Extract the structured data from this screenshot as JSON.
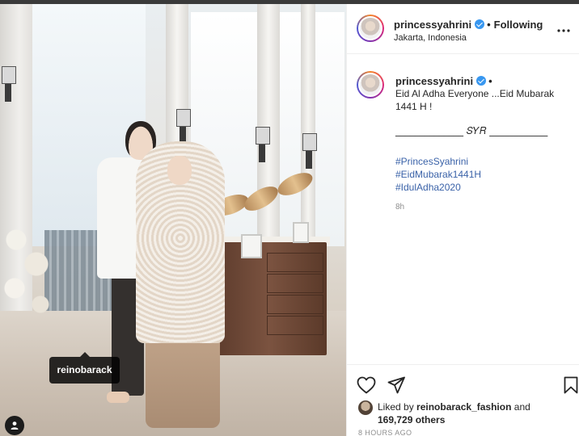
{
  "photo": {
    "tag_label": "reinobarack",
    "tagged_icon": "person-icon"
  },
  "post_header": {
    "username": "princessyahrini",
    "separator": "•",
    "follow_label": "Following",
    "location": "Jakarta, Indonesia",
    "more_icon": "ellipsis-icon"
  },
  "caption": {
    "username": "princessyahrini",
    "separator": "•",
    "text": "Eid Al Adha Everyone ...Eid Mubarak 1441 H !",
    "signature": "______________ 𝑆𝑌𝑅 ____________",
    "hashtags": [
      "#PrincesSyahrini",
      "#EidMubarak1441H",
      "#IdulAdha2020"
    ],
    "time_ago": "8h"
  },
  "actions": {
    "like_icon": "heart-icon",
    "share_icon": "paper-plane-icon",
    "save_icon": "bookmark-icon",
    "liked_by_prefix": "Liked by",
    "liked_by_user": "reinobarack_fashion",
    "and_label": "and",
    "others_count": "169,729 others",
    "posted": "8 HOURS AGO"
  },
  "colors": {
    "link": "#3a62a8",
    "verified": "#3897f0",
    "muted": "#8e8e8e"
  }
}
